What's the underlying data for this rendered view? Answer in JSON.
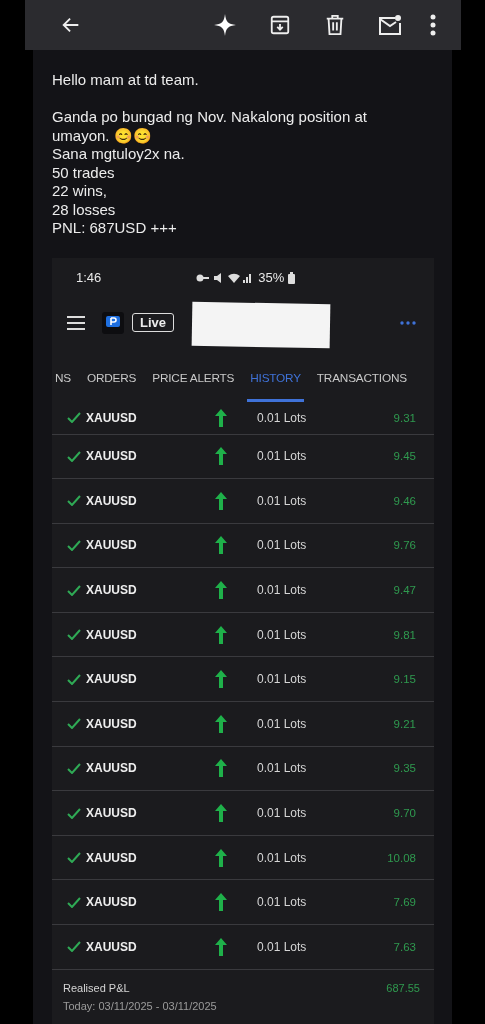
{
  "email": {
    "paragraphs": [
      [
        "Hello mam at td team."
      ],
      [
        "Ganda po bungad ng Nov. Nakalong position at umayon. 😊😊",
        "Sana mgtuloy2x na.",
        "50 trades",
        "22 wins,",
        "28 losses",
        "PNL: 687USD +++"
      ]
    ]
  },
  "screenshot": {
    "status_bar": {
      "time": "1:46",
      "battery": "35%"
    },
    "header": {
      "account_badge": "Live"
    },
    "tabs": [
      {
        "label": "NS",
        "selected": false
      },
      {
        "label": "ORDERS",
        "selected": false
      },
      {
        "label": "PRICE ALERTS",
        "selected": false
      },
      {
        "label": "HISTORY",
        "selected": true
      },
      {
        "label": "TRANSACTIONS",
        "selected": false
      }
    ],
    "trades": [
      {
        "symbol": "XAUUSD",
        "volume": "0.01 Lots",
        "profit": "9.31"
      },
      {
        "symbol": "XAUUSD",
        "volume": "0.01 Lots",
        "profit": "9.45"
      },
      {
        "symbol": "XAUUSD",
        "volume": "0.01 Lots",
        "profit": "9.46"
      },
      {
        "symbol": "XAUUSD",
        "volume": "0.01 Lots",
        "profit": "9.76"
      },
      {
        "symbol": "XAUUSD",
        "volume": "0.01 Lots",
        "profit": "9.47"
      },
      {
        "symbol": "XAUUSD",
        "volume": "0.01 Lots",
        "profit": "9.81"
      },
      {
        "symbol": "XAUUSD",
        "volume": "0.01 Lots",
        "profit": "9.15"
      },
      {
        "symbol": "XAUUSD",
        "volume": "0.01 Lots",
        "profit": "9.21"
      },
      {
        "symbol": "XAUUSD",
        "volume": "0.01 Lots",
        "profit": "9.35"
      },
      {
        "symbol": "XAUUSD",
        "volume": "0.01 Lots",
        "profit": "9.70"
      },
      {
        "symbol": "XAUUSD",
        "volume": "0.01 Lots",
        "profit": "10.08"
      },
      {
        "symbol": "XAUUSD",
        "volume": "0.01 Lots",
        "profit": "7.69"
      },
      {
        "symbol": "XAUUSD",
        "volume": "0.01 Lots",
        "profit": "7.63"
      }
    ],
    "summary": {
      "label": "Realised P&L",
      "value": "687.55",
      "period": "Today: 03/11/2025 - 03/11/2025"
    }
  }
}
